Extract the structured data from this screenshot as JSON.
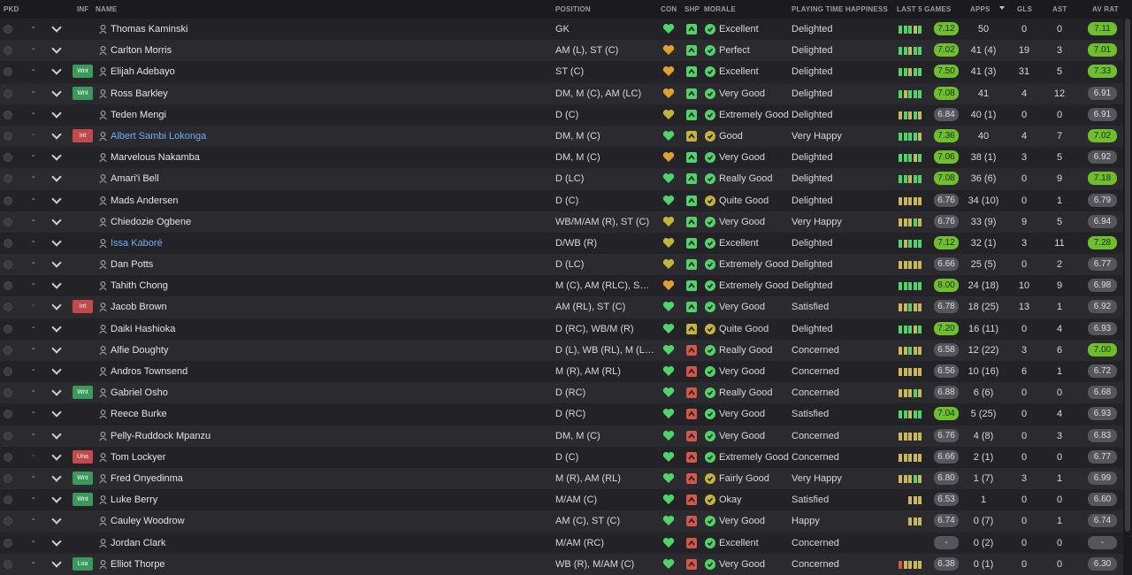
{
  "colors": {
    "green": "#4fd46a",
    "yellow": "#c4b43a",
    "red": "#d0584a",
    "orange": "#e0a030",
    "link": "#6ab0f0"
  },
  "headers": {
    "pkd": "PKD",
    "inf": "INF",
    "name": "NAME",
    "position": "POSITION",
    "con": "CON",
    "shp": "SHP",
    "morale": "MORALE",
    "pth": "PLAYING TIME HAPPINESS",
    "last5": "LAST 5 GAMES",
    "apps": "APPS",
    "gls": "GLS",
    "ast": "AST",
    "avrat": "AV RAT"
  },
  "players": [
    {
      "pkd": "-",
      "inf": "",
      "name": "Thomas Kaminski",
      "pos": "GK",
      "con": "green",
      "shp": "green",
      "morale": "Excellent",
      "morale_icon": "green",
      "pth": "Delighted",
      "bars": [
        "g",
        "g",
        "g",
        "y",
        "g"
      ],
      "l5": "7.12",
      "l5_hi": true,
      "apps": "50",
      "gls": "0",
      "ast": "0",
      "av": "7.11",
      "av_hi": true
    },
    {
      "pkd": "-",
      "inf": "",
      "name": "Carlton Morris",
      "pos": "AM (L), ST (C)",
      "con": "orange",
      "shp": "green",
      "morale": "Perfect",
      "morale_icon": "green",
      "pth": "Delighted",
      "bars": [
        "g",
        "g",
        "y",
        "g",
        "g"
      ],
      "l5": "7.02",
      "l5_hi": true,
      "apps": "41 (4)",
      "gls": "19",
      "ast": "3",
      "av": "7.01",
      "av_hi": true
    },
    {
      "pkd": "-",
      "inf": "Wnt",
      "name": "Elijah Adebayo",
      "pos": "ST (C)",
      "con": "orange",
      "shp": "green",
      "morale": "Excellent",
      "morale_icon": "green",
      "pth": "Delighted",
      "bars": [
        "g",
        "g",
        "y",
        "g",
        "g"
      ],
      "l5": "7.50",
      "l5_hi": true,
      "apps": "41 (3)",
      "gls": "31",
      "ast": "5",
      "av": "7.33",
      "av_hi": true
    },
    {
      "pkd": "-",
      "inf": "Wnt",
      "name": "Ross Barkley",
      "pos": "DM, M (C), AM (LC)",
      "con": "orange",
      "shp": "green",
      "morale": "Very Good",
      "morale_icon": "green",
      "pth": "Delighted",
      "bars": [
        "g",
        "y",
        "g",
        "g",
        "g"
      ],
      "l5": "7.08",
      "l5_hi": true,
      "apps": "41",
      "gls": "4",
      "ast": "12",
      "av": "6.91",
      "av_hi": false
    },
    {
      "pkd": "-",
      "inf": "",
      "name": "Teden Mengi",
      "pos": "D (C)",
      "con": "yellow",
      "shp": "green",
      "morale": "Extremely Good",
      "morale_icon": "green",
      "pth": "Delighted",
      "bars": [
        "y",
        "g",
        "y",
        "g",
        "y"
      ],
      "l5": "6.84",
      "l5_hi": false,
      "apps": "40 (1)",
      "gls": "0",
      "ast": "0",
      "av": "6.91",
      "av_hi": false
    },
    {
      "pkd": "-",
      "inf": "Int",
      "name": "Albert Sambi Lokonga",
      "name_link": true,
      "pos": "DM, M (C)",
      "con": "green",
      "shp": "yellow",
      "morale": "Good",
      "morale_icon": "yellow",
      "pth": "Very Happy",
      "bars": [
        "g",
        "g",
        "g",
        "g",
        "y"
      ],
      "l5": "7.36",
      "l5_hi": true,
      "apps": "40",
      "gls": "4",
      "ast": "7",
      "av": "7.02",
      "av_hi": true
    },
    {
      "pkd": "-",
      "inf": "",
      "name": "Marvelous Nakamba",
      "pos": "DM, M (C)",
      "con": "orange",
      "shp": "green",
      "morale": "Very Good",
      "morale_icon": "green",
      "pth": "Delighted",
      "bars": [
        "g",
        "g",
        "g",
        "y",
        "g"
      ],
      "l5": "7.06",
      "l5_hi": true,
      "apps": "38 (1)",
      "gls": "3",
      "ast": "5",
      "av": "6.92",
      "av_hi": false
    },
    {
      "pkd": "-",
      "inf": "",
      "name": "Amari'i Bell",
      "pos": "D (LC)",
      "con": "green",
      "shp": "green",
      "morale": "Really Good",
      "morale_icon": "green",
      "pth": "Delighted",
      "bars": [
        "g",
        "g",
        "y",
        "g",
        "g"
      ],
      "l5": "7.08",
      "l5_hi": true,
      "apps": "36 (6)",
      "gls": "0",
      "ast": "9",
      "av": "7.18",
      "av_hi": true
    },
    {
      "pkd": "-",
      "inf": "",
      "name": "Mads Andersen",
      "pos": "D (C)",
      "con": "green",
      "shp": "green",
      "morale": "Quite Good",
      "morale_icon": "yellow",
      "pth": "Delighted",
      "bars": [
        "y",
        "y",
        "y",
        "y",
        "y"
      ],
      "l5": "6.76",
      "l5_hi": false,
      "apps": "34 (10)",
      "gls": "0",
      "ast": "1",
      "av": "6.79",
      "av_hi": false
    },
    {
      "pkd": "-",
      "inf": "",
      "name": "Chiedozie Ogbene",
      "pos": "WB/M/AM (R), ST (C)",
      "con": "yellow",
      "shp": "green",
      "morale": "Very Good",
      "morale_icon": "green",
      "pth": "Very Happy",
      "bars": [
        "y",
        "y",
        "y",
        "g",
        "y"
      ],
      "l5": "6.76",
      "l5_hi": false,
      "apps": "33 (9)",
      "gls": "9",
      "ast": "5",
      "av": "6.94",
      "av_hi": false
    },
    {
      "pkd": "-",
      "inf": "",
      "name": "Issa Kaboré",
      "name_link": true,
      "pos": "D/WB (R)",
      "con": "yellow",
      "shp": "green",
      "morale": "Excellent",
      "morale_icon": "green",
      "pth": "Delighted",
      "bars": [
        "g",
        "y",
        "g",
        "g",
        "g"
      ],
      "l5": "7.12",
      "l5_hi": true,
      "apps": "32 (1)",
      "gls": "3",
      "ast": "11",
      "av": "7.28",
      "av_hi": true
    },
    {
      "pkd": "-",
      "inf": "",
      "name": "Dan Potts",
      "pos": "D (LC)",
      "con": "yellow",
      "shp": "green",
      "morale": "Extremely Good",
      "morale_icon": "green",
      "pth": "Delighted",
      "bars": [
        "y",
        "y",
        "y",
        "y",
        "y"
      ],
      "l5": "6.66",
      "l5_hi": false,
      "apps": "25 (5)",
      "gls": "0",
      "ast": "2",
      "av": "6.77",
      "av_hi": false
    },
    {
      "pkd": "-",
      "inf": "",
      "name": "Tahith Chong",
      "pos": "M (C), AM (RLC), ST (C)",
      "con": "orange",
      "shp": "green",
      "morale": "Extremely Good",
      "morale_icon": "green",
      "pth": "Delighted",
      "bars": [
        "g",
        "g",
        "g",
        "g",
        "g"
      ],
      "l5": "8.00",
      "l5_hi": true,
      "apps": "24 (18)",
      "gls": "10",
      "ast": "9",
      "av": "6.98",
      "av_hi": false
    },
    {
      "pkd": "-",
      "inf": "Int",
      "name": "Jacob Brown",
      "pos": "AM (RL), ST (C)",
      "con": "green",
      "shp": "green",
      "morale": "Very Good",
      "morale_icon": "green",
      "pth": "Satisfied",
      "bars": [
        "y",
        "y",
        "g",
        "y",
        "y"
      ],
      "l5": "6.78",
      "l5_hi": false,
      "apps": "18 (25)",
      "gls": "13",
      "ast": "1",
      "av": "6.92",
      "av_hi": false
    },
    {
      "pkd": "-",
      "inf": "",
      "name": "Daiki Hashioka",
      "pos": "D (RC), WB/M (R)",
      "con": "green",
      "shp": "yellow",
      "morale": "Quite Good",
      "morale_icon": "yellow",
      "pth": "Delighted",
      "bars": [
        "g",
        "g",
        "g",
        "y",
        "g"
      ],
      "l5": "7.20",
      "l5_hi": true,
      "apps": "16 (11)",
      "gls": "0",
      "ast": "4",
      "av": "6.93",
      "av_hi": false
    },
    {
      "pkd": "-",
      "inf": "",
      "name": "Alfie Doughty",
      "pos": "D (L), WB (RL), M (L),...",
      "con": "green",
      "shp": "red",
      "morale": "Really Good",
      "morale_icon": "green",
      "pth": "Concerned",
      "bars": [
        "y",
        "y",
        "g",
        "y",
        "y"
      ],
      "l5": "6.58",
      "l5_hi": false,
      "apps": "12 (22)",
      "gls": "3",
      "ast": "6",
      "av": "7.00",
      "av_hi": true
    },
    {
      "pkd": "-",
      "inf": "",
      "name": "Andros Townsend",
      "pos": "M (R), AM (RL)",
      "con": "green",
      "shp": "red",
      "morale": "Very Good",
      "morale_icon": "green",
      "pth": "Concerned",
      "bars": [
        "y",
        "y",
        "y",
        "y",
        "y"
      ],
      "l5": "6.56",
      "l5_hi": false,
      "apps": "10 (16)",
      "gls": "6",
      "ast": "1",
      "av": "6.72",
      "av_hi": false
    },
    {
      "pkd": "-",
      "inf": "Wnt",
      "name": "Gabriel Osho",
      "pos": "D (RC)",
      "con": "green",
      "shp": "red",
      "morale": "Really Good",
      "morale_icon": "green",
      "pth": "Concerned",
      "bars": [
        "y",
        "y",
        "y",
        "g",
        "y"
      ],
      "l5": "6.88",
      "l5_hi": false,
      "apps": "6 (6)",
      "gls": "0",
      "ast": "0",
      "av": "6.68",
      "av_hi": false
    },
    {
      "pkd": "-",
      "inf": "",
      "name": "Reece Burke",
      "pos": "D (RC)",
      "con": "green",
      "shp": "red",
      "morale": "Very Good",
      "morale_icon": "green",
      "pth": "Satisfied",
      "bars": [
        "g",
        "g",
        "y",
        "g",
        "g"
      ],
      "l5": "7.04",
      "l5_hi": true,
      "apps": "5 (25)",
      "gls": "0",
      "ast": "4",
      "av": "6.93",
      "av_hi": false
    },
    {
      "pkd": "-",
      "inf": "",
      "name": "Pelly-Ruddock Mpanzu",
      "pos": "DM, M (C)",
      "con": "green",
      "shp": "red",
      "morale": "Very Good",
      "morale_icon": "green",
      "pth": "Concerned",
      "bars": [
        "y",
        "y",
        "y",
        "y",
        "y"
      ],
      "l5": "6.76",
      "l5_hi": false,
      "apps": "4 (8)",
      "gls": "0",
      "ast": "3",
      "av": "6.83",
      "av_hi": false
    },
    {
      "pkd": "-",
      "inf": "Una",
      "name": "Tom Lockyer",
      "pos": "D (C)",
      "con": "green",
      "shp": "red",
      "morale": "Extremely Good",
      "morale_icon": "green",
      "pth": "Concerned",
      "bars": [
        "y",
        "y",
        "y",
        "y",
        "y"
      ],
      "l5": "6.66",
      "l5_hi": false,
      "apps": "2 (1)",
      "gls": "0",
      "ast": "0",
      "av": "6.77",
      "av_hi": false
    },
    {
      "pkd": "-",
      "inf": "Wnt",
      "name": "Fred Onyedinma",
      "pos": "M (R), AM (RL)",
      "con": "green",
      "shp": "red",
      "morale": "Fairly Good",
      "morale_icon": "yellow",
      "pth": "Very Happy",
      "bars": [
        "y",
        "y",
        "y",
        "g",
        "y"
      ],
      "l5": "6.80",
      "l5_hi": false,
      "apps": "1 (7)",
      "gls": "3",
      "ast": "1",
      "av": "6.99",
      "av_hi": false
    },
    {
      "pkd": "-",
      "inf": "Wnt",
      "name": "Luke Berry",
      "pos": "M/AM (C)",
      "con": "green",
      "shp": "red",
      "morale": "Okay",
      "morale_icon": "yellow",
      "pth": "Satisfied",
      "bars": [
        "y",
        "y",
        "y"
      ],
      "l5": "6.53",
      "l5_hi": false,
      "apps": "1",
      "gls": "0",
      "ast": "0",
      "av": "6.60",
      "av_hi": false
    },
    {
      "pkd": "-",
      "inf": "",
      "name": "Cauley Woodrow",
      "pos": "AM (C), ST (C)",
      "con": "green",
      "shp": "red",
      "morale": "Very Good",
      "morale_icon": "green",
      "pth": "Happy",
      "bars": [
        "y",
        "y",
        "y"
      ],
      "l5": "6.74",
      "l5_hi": false,
      "apps": "0 (7)",
      "gls": "0",
      "ast": "1",
      "av": "6.74",
      "av_hi": false
    },
    {
      "pkd": "-",
      "inf": "",
      "name": "Jordan Clark",
      "pos": "M/AM (RC)",
      "con": "green",
      "shp": "red",
      "morale": "Excellent",
      "morale_icon": "green",
      "pth": "Concerned",
      "bars": [],
      "l5": "-",
      "l5_hi": false,
      "apps": "0 (2)",
      "gls": "0",
      "ast": "0",
      "av": "-",
      "av_hi": false
    },
    {
      "pkd": "-",
      "inf": "Loa",
      "name": "Elliot Thorpe",
      "pos": "WB (R), M/AM (C)",
      "con": "green",
      "shp": "red",
      "morale": "Very Good",
      "morale_icon": "green",
      "pth": "Concerned",
      "bars": [
        "r",
        "y",
        "y",
        "y",
        "y"
      ],
      "l5": "6.38",
      "l5_hi": false,
      "apps": "0 (1)",
      "gls": "0",
      "ast": "0",
      "av": "6.30",
      "av_hi": false
    }
  ]
}
